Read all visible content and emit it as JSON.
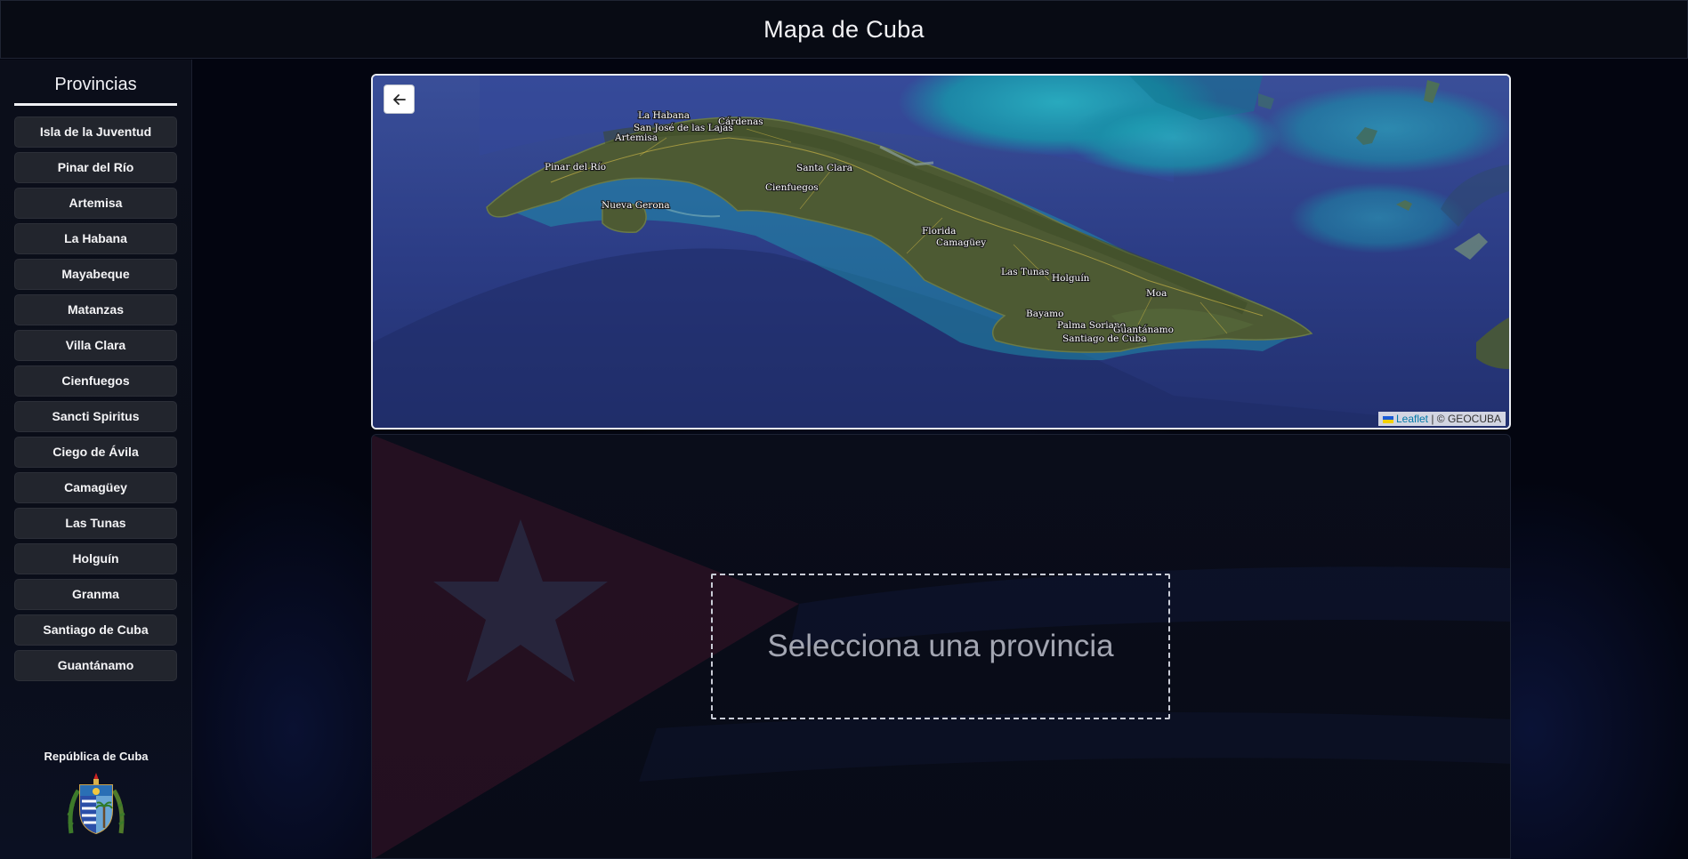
{
  "header": {
    "title": "Mapa de Cuba"
  },
  "sidebar": {
    "title": "Provincias",
    "provinces": [
      "Isla de la Juventud",
      "Pinar del Río",
      "Artemisa",
      "La Habana",
      "Mayabeque",
      "Matanzas",
      "Villa Clara",
      "Cienfuegos",
      "Sancti Spiritus",
      "Ciego de Ávila",
      "Camagüey",
      "Las Tunas",
      "Holguín",
      "Granma",
      "Santiago de Cuba",
      "Guantánamo"
    ],
    "footer_label": "República de Cuba"
  },
  "map": {
    "back_icon": "arrow-left-icon",
    "attribution_link": "Leaflet",
    "attribution_text": " | © GEOCUBA",
    "city_labels": [
      "La Habana",
      "San José de las Lajas",
      "Artemisa",
      "Cárdenas",
      "Pinar del Río",
      "Santa Clara",
      "Cienfuegos",
      "Nueva Gerona",
      "Florida",
      "Camagüey",
      "Las Tunas",
      "Holguín",
      "Moa",
      "Bayamo",
      "Palma Soriano",
      "Guantánamo",
      "Santiago de Cuba"
    ]
  },
  "panel": {
    "placeholder": "Selecciona una provincia"
  },
  "colors": {
    "ocean_deep": "#2d3f86",
    "shallow_sea": "#1fa3b8",
    "land": "#4d5a33",
    "button_bg": "#22252d"
  }
}
